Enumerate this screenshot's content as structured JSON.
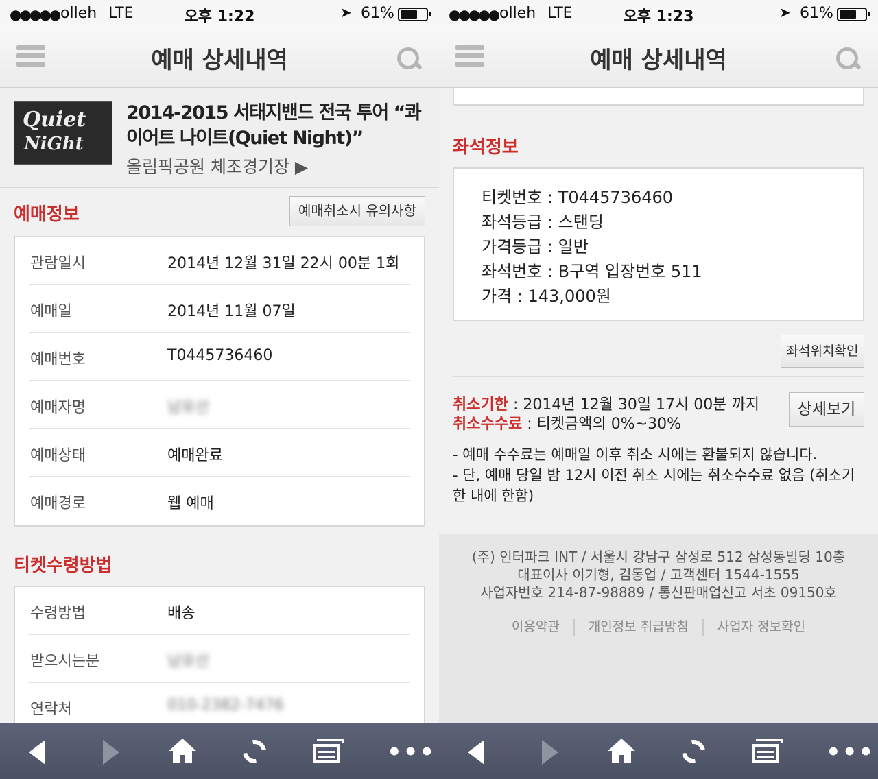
{
  "status": {
    "signal": "●●●●●",
    "carrier": "olleh",
    "network": "LTE",
    "time_left": "오후 1:22",
    "time_right": "오후 1:23",
    "battery": "61%"
  },
  "header": {
    "title": "예매 상세내역"
  },
  "event": {
    "poster_line1": "Quiet",
    "poster_line2": "NiGht",
    "name": "2014-2015 서태지밴드 전국 투어 “콰이어트 나이트(Quiet Night)”",
    "venue": "올림픽공원 체조경기장 ▶"
  },
  "booking": {
    "title": "예매정보",
    "cancel_notice_button": "예매취소시 유의사항",
    "rows": [
      {
        "label": "관람일시",
        "value": "2014년 12월 31일 22시 00분 1회"
      },
      {
        "label": "예매일",
        "value": "2014년 11월 07일"
      },
      {
        "label": "예매번호",
        "value": "T0445736460"
      },
      {
        "label": "예매자명",
        "value": "남유선"
      },
      {
        "label": "예매상태",
        "value": "예매완료"
      },
      {
        "label": "예매경로",
        "value": "웹 예매"
      }
    ]
  },
  "receipt": {
    "title": "티켓수령방법",
    "rows": [
      {
        "label": "수령방법",
        "value": "배송"
      },
      {
        "label": "받으시는분",
        "value": "남유선"
      },
      {
        "label": "연락처",
        "value": "010-2382-7476"
      }
    ]
  },
  "seat": {
    "title": "좌석정보",
    "lines": [
      "티켓번호 : T0445736460",
      "좌석등급 : 스탠딩",
      "가격등급 : 일반",
      "좌석번호 : B구역 입장번호 511",
      "가격 : 143,000원"
    ],
    "location_button": "좌석위치확인"
  },
  "cancel": {
    "deadline_label": "취소기한",
    "deadline_value": " : 2014년 12월 30일 17시 00분 까지",
    "fee_label": "취소수수료",
    "fee_value": " : 티켓금액의 0%~30%",
    "detail_button": "상세보기",
    "notes": [
      "- 예매 수수료는 예매일 이후 취소 시에는 환불되지 않습니다.",
      "- 단, 예매 당일 밤 12시 이전 취소 시에는 취소수수료 없음 (취소기한 내에 한함)"
    ]
  },
  "footer": {
    "line1": "(주) 인터파크 INT / 서울시 강남구 삼성로 512 삼성동빌딩 10층",
    "line2": "대표이사 이기형, 김동업 / 고객센터 1544-1555",
    "line3": "사업자번호 214-87-98889 / 통신판매업신고 서초 09150호",
    "links": [
      "이용약관",
      "개인정보 취급방침",
      "사업자 정보확인"
    ]
  },
  "toolbar": {
    "icons": [
      "back-icon",
      "forward-icon",
      "home-icon",
      "refresh-icon",
      "tabs-icon",
      "more-icon"
    ],
    "more_glyph": "•••"
  }
}
